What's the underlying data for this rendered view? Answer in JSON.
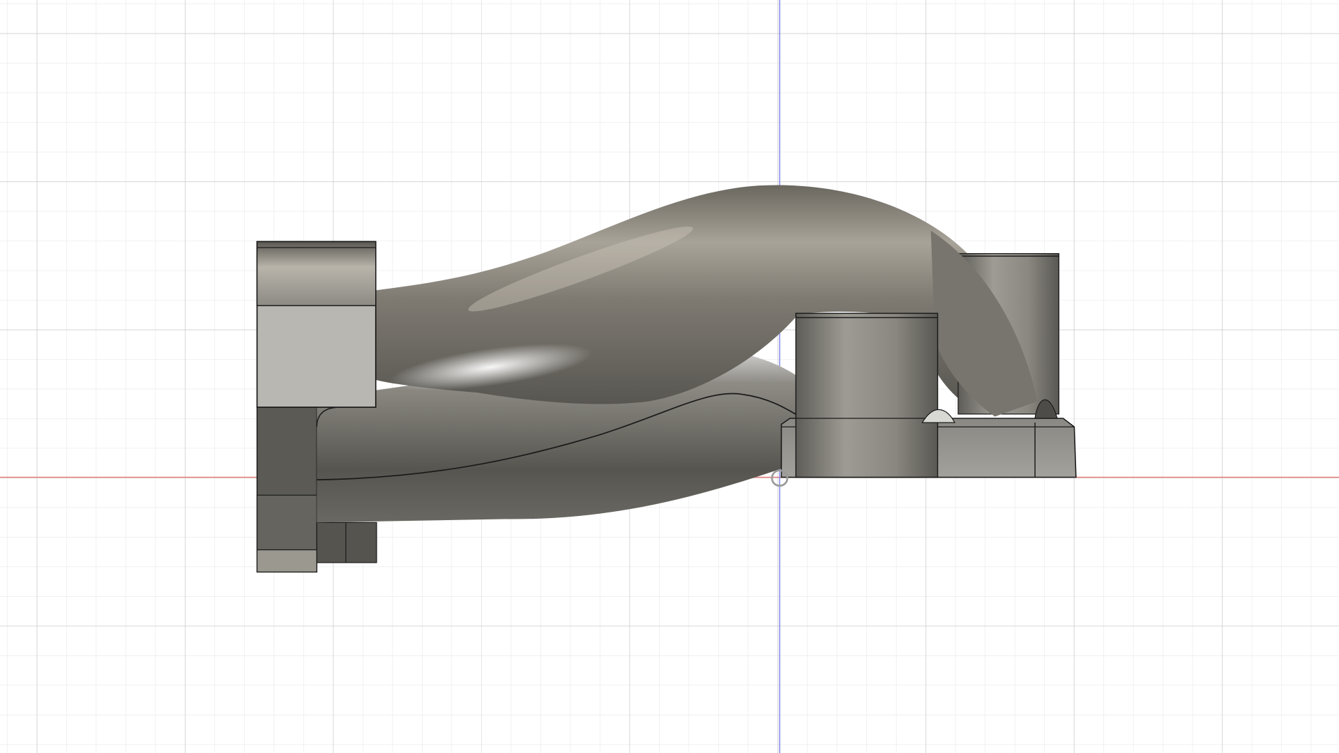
{
  "app": {
    "view": "orthographic-front",
    "background_color": "#ffffff"
  },
  "grid": {
    "visible": true,
    "minor_color": "#e6e6e6",
    "major_color": "#cfcfcf"
  },
  "axes": {
    "x_axis_color": "#e88080",
    "y_axis_color": "#7f86e6"
  },
  "model": {
    "name_icon": "intake-manifold-part",
    "body_color": "#8a877f",
    "edge_color": "#1a1a1a"
  }
}
